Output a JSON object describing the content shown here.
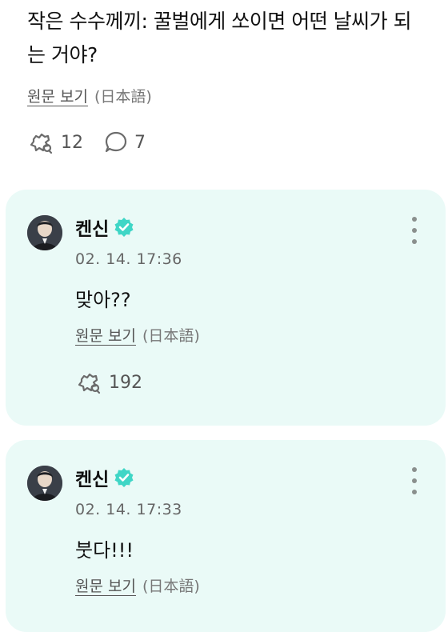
{
  "post": {
    "title": "작은 수수께끼: 꿀벌에게 쏘이면 어떤 날씨가 되는 거야?",
    "translate_label": "원문 보기",
    "translate_lang": "(日本語)",
    "reactions_count": "12",
    "comments_count": "7"
  },
  "comments": [
    {
      "author": "켄신",
      "time": "02. 14. 17:36",
      "text": "맞아??",
      "translate_label": "원문 보기",
      "translate_lang": "(日本語)",
      "reactions_count": "192"
    },
    {
      "author": "켄신",
      "time": "02. 14. 17:33",
      "text": "붓다!!!",
      "translate_label": "원문 보기",
      "translate_lang": "(日本語)"
    }
  ],
  "colors": {
    "card_bg": "#eafaf7",
    "verified": "#3fd6c6",
    "muted": "#555555"
  },
  "icons": [
    "reaction-icon",
    "comment-icon",
    "verified-icon",
    "more-icon",
    "avatar"
  ]
}
